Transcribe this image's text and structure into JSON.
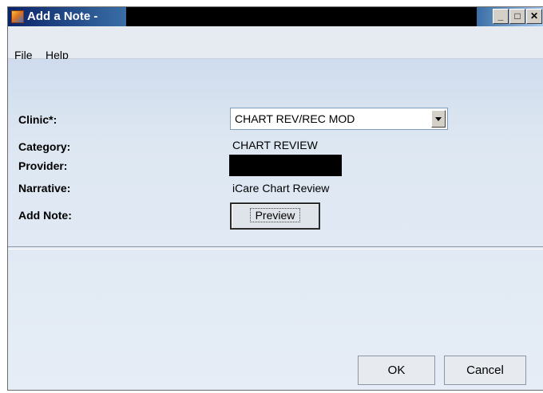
{
  "window": {
    "title": "Add a Note -",
    "icons": {
      "app": "app-icon",
      "minimize": "minimize-icon",
      "maximize": "maximize-icon",
      "close": "close-icon"
    }
  },
  "menu": [
    {
      "label": "File"
    },
    {
      "label": "Help"
    }
  ],
  "form": {
    "clinic": {
      "label": "Clinic*:",
      "value": "CHART REV/REC MOD"
    },
    "category": {
      "label": "Category:",
      "value": "CHART REVIEW"
    },
    "provider": {
      "label": "Provider:"
    },
    "narrative": {
      "label": "Narrative:",
      "value": "iCare Chart Review"
    },
    "add_note": {
      "label": "Add Note:",
      "button": "Preview"
    }
  },
  "footer": {
    "ok_label": "OK",
    "cancel_label": "Cancel"
  }
}
